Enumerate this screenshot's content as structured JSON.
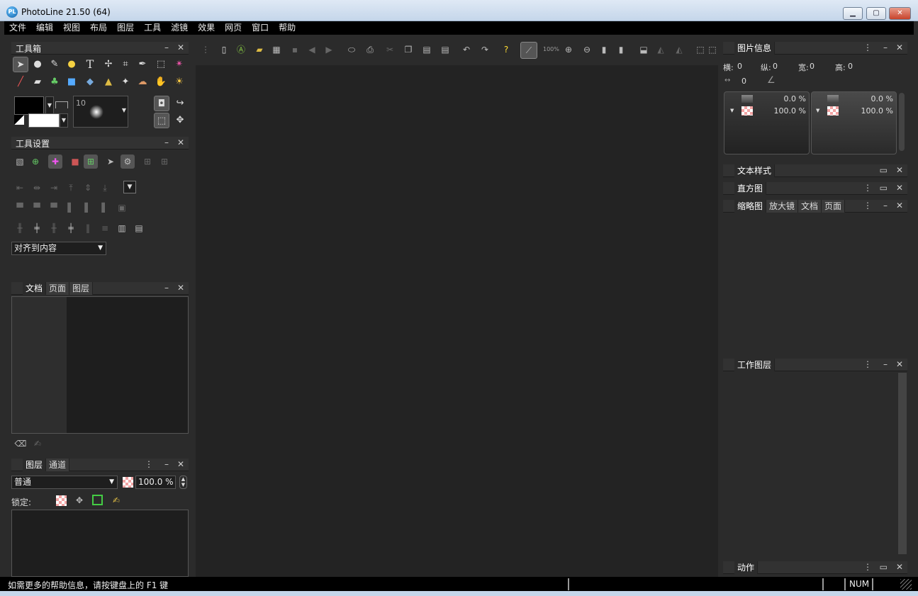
{
  "window": {
    "title": "PhotoLine 21.50 (64)",
    "app_icon": "PL",
    "min": "▁",
    "max": "▢",
    "close": "✕"
  },
  "menu": [
    "文件",
    "编辑",
    "视图",
    "布局",
    "图层",
    "工具",
    "滤镜",
    "效果",
    "网页",
    "窗口",
    "帮助"
  ],
  "toolbox": {
    "title": "工具箱",
    "brush_size": "10"
  },
  "tool_settings": {
    "title": "工具设置",
    "align_option": "对齐到内容"
  },
  "doc_panel": {
    "tabs": [
      "文档",
      "页面",
      "图层"
    ]
  },
  "layers_panel": {
    "tabs": [
      "图层",
      "通道"
    ],
    "blend_mode": "普通",
    "opacity": "100.0 %",
    "lock_label": "锁定:"
  },
  "toolbar": {
    "zoom": "100%"
  },
  "image_info": {
    "title": "图片信息",
    "x_label": "横:",
    "x_value": "0",
    "y_label": "纵:",
    "y_value": "0",
    "w_label": "宽:",
    "w_value": "0",
    "h_label": "高:",
    "h_value": "0",
    "dist_value": "0",
    "left_top_pct": "0.0 %",
    "left_bottom_pct": "100.0 %",
    "right_top_pct": "0.0 %",
    "right_bottom_pct": "100.0 %"
  },
  "text_style": {
    "title": "文本样式"
  },
  "histogram": {
    "title": "直方图"
  },
  "nav_panel": {
    "tabs": [
      "缩略图",
      "放大镜",
      "文档",
      "页面"
    ]
  },
  "work_layers": {
    "title": "工作图层"
  },
  "actions": {
    "title": "动作"
  },
  "status": {
    "help": "如需更多的帮助信息，请按键盘上的 F1 键",
    "num": "NUM"
  }
}
